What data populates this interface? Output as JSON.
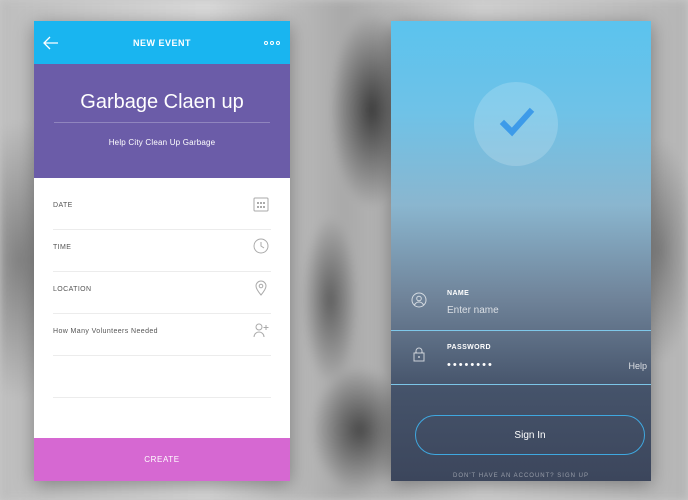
{
  "left_screen": {
    "header": {
      "title": "NEW EVENT"
    },
    "event": {
      "title": "Garbage Claen up",
      "subtitle": "Help City Clean Up Garbage"
    },
    "fields": [
      {
        "label": "DATE",
        "icon": "calendar-icon"
      },
      {
        "label": "TIME",
        "icon": "clock-icon"
      },
      {
        "label": "LOCATION",
        "icon": "location-pin-icon"
      },
      {
        "label": "How Many Volunteers Needed",
        "icon": "add-user-icon"
      }
    ],
    "create_label": "CREATE",
    "colors": {
      "header": "#19b5f0",
      "hero": "#6b5ca8",
      "create": "#d668d2"
    }
  },
  "right_screen": {
    "name": {
      "label": "NAME",
      "placeholder": "Enter name",
      "icon": "user-icon"
    },
    "password": {
      "label": "PASSWORD",
      "value": "••••••••",
      "help": "Help",
      "icon": "lock-icon"
    },
    "signin_label": "Sign In",
    "bottom_hint": "DON'T HAVE AN ACCOUNT? SIGN UP",
    "colors": {
      "accent": "#3fa8e0",
      "check": "#3d9be9"
    }
  }
}
